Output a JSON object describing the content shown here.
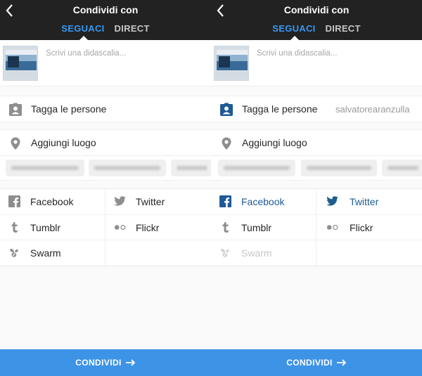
{
  "colors": {
    "accent": "#3897f0",
    "header_bg": "#222222",
    "facebook_active": "#1f5a96",
    "twitter_active": "#1e5d8e",
    "share_button_bg": "#3d93e6"
  },
  "left": {
    "header": {
      "title": "Condividi con",
      "tabs": [
        "SEGUACI",
        "DIRECT"
      ],
      "active_tab": "SEGUACI"
    },
    "caption_placeholder": "Scrivi una didascalia...",
    "tag_people": {
      "label": "Tagga le persone",
      "value": ""
    },
    "add_location": {
      "label": "Aggiungi luogo"
    },
    "share_targets": {
      "facebook": "Facebook",
      "twitter": "Twitter",
      "tumblr": "Tumblr",
      "flickr": "Flickr",
      "swarm": "Swarm"
    },
    "share_button": "CONDIVIDI"
  },
  "right": {
    "header": {
      "title": "Condividi con",
      "tabs": [
        "SEGUACI",
        "DIRECT"
      ],
      "active_tab": "SEGUACI"
    },
    "caption_placeholder": "Scrivi una didascalia...",
    "tag_people": {
      "label": "Tagga le persone",
      "value": "salvatorearanzulla"
    },
    "add_location": {
      "label": "Aggiungi luogo"
    },
    "share_targets": {
      "facebook": "Facebook",
      "twitter": "Twitter",
      "tumblr": "Tumblr",
      "flickr": "Flickr",
      "swarm": "Swarm"
    },
    "share_button": "CONDIVIDI"
  },
  "icons": {
    "back": "chevron-left-icon",
    "tag_people": "person-badge-icon",
    "location": "location-pin-icon",
    "facebook": "facebook-icon",
    "twitter": "twitter-icon",
    "tumblr": "tumblr-icon",
    "flickr": "flickr-icon",
    "swarm": "swarm-icon",
    "share_arrow": "arrow-right-icon"
  }
}
